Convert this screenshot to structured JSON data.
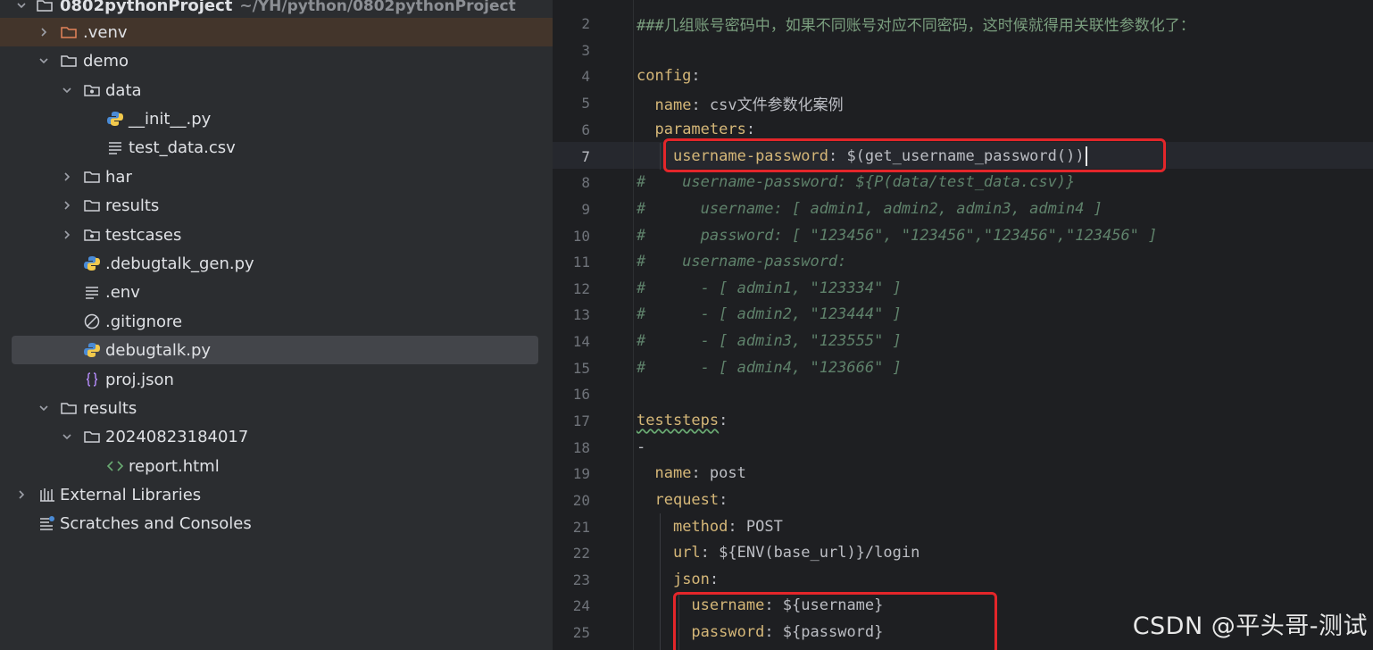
{
  "project": {
    "name": "0802pythonProject",
    "path": "~/YH/python/0802pythonProject"
  },
  "tree": {
    "venv": ".venv",
    "demo": "demo",
    "data": "data",
    "init_py": "__init__.py",
    "test_data_csv": "test_data.csv",
    "har": "har",
    "results_demo": "results",
    "testcases": "testcases",
    "debugtalk_gen": ".debugtalk_gen.py",
    "env": ".env",
    "gitignore": ".gitignore",
    "debugtalk": "debugtalk.py",
    "proj_json": "proj.json",
    "results": "results",
    "run_folder": "20240823184017",
    "report": "report.html",
    "external_libraries": "External Libraries",
    "scratches": "Scratches and Consoles"
  },
  "editor": {
    "line_numbers": [
      "2",
      "3",
      "4",
      "5",
      "6",
      "7",
      "8",
      "9",
      "10",
      "11",
      "12",
      "13",
      "14",
      "15",
      "16",
      "17",
      "18",
      "19",
      "20",
      "21",
      "22",
      "23",
      "24",
      "25"
    ],
    "l2_comment": "###几组账号密码中，如果不同账号对应不同密码，这时候就得用关联性参数化了：",
    "l4_key": "config",
    "l5_key": "name",
    "l5_val": "csv文件参数化案例",
    "l6_key": "parameters",
    "l7_key": "username-password",
    "l7_val": "$(get_username_password()",
    "l7_tail": ")",
    "l8": "#    username-password: ${P(data/test_data.csv)}",
    "l9": "#      username: [ admin1, admin2, admin3, admin4 ]",
    "l10": "#      password: [ \"123456\", \"123456\",\"123456\",\"123456\" ]",
    "l11": "#    username-password:",
    "l12": "#      - [ admin1, \"123334\" ]",
    "l13": "#      - [ admin2, \"123444\" ]",
    "l14": "#      - [ admin3, \"123555\" ]",
    "l15": "#      - [ admin4, \"123666\" ]",
    "l17_key": "teststeps",
    "l18": "-",
    "l19_key": "name",
    "l19_val": "post",
    "l20_key": "request",
    "l21_key": "method",
    "l21_val": "POST",
    "l22_key": "url",
    "l22_val": "${ENV(base_url)}/login",
    "l23_key": "json",
    "l24_key": "username",
    "l24_val": "${username}",
    "l25_key": "password",
    "l25_val": "${password}"
  },
  "watermark": "CSDN @平头哥-测试",
  "colors": {
    "tree_bg": "#2b2d30",
    "editor_bg": "#1e1f22",
    "yaml_key": "#d5b778",
    "comment": "#5f826b",
    "highlight_box": "#e3262a",
    "selected_row": "#43454a"
  }
}
